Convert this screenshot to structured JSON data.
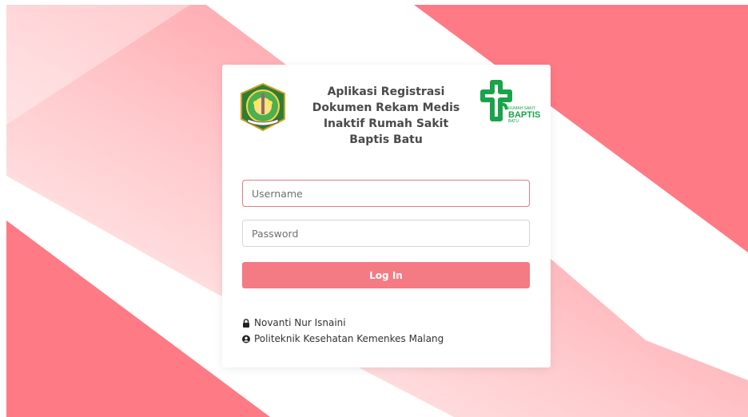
{
  "app": {
    "title": "Aplikasi Registrasi Dokumen Rekam Medis Inaktif Rumah Sakit Baptis Batu",
    "title_lines": [
      "Aplikasi Registrasi",
      "Dokumen Rekam Medis",
      "Inaktif Rumah Sakit",
      "Baptis Batu"
    ]
  },
  "logos": {
    "left": {
      "icon": "government-seal-icon"
    },
    "right": {
      "icon": "rumah-sakit-baptis-batu-logo",
      "text_top": "RUMAH SAKIT",
      "text_main": "BAPTIS",
      "text_bottom": "BATU"
    }
  },
  "form": {
    "username": {
      "placeholder": "Username",
      "value": ""
    },
    "password": {
      "placeholder": "Password",
      "value": ""
    },
    "login_label": "Log In"
  },
  "credits": [
    {
      "icon": "lock-icon",
      "text": "Novanti Nur Isnaini"
    },
    {
      "icon": "user-circle-icon",
      "text": "Politeknik Kesehatan Kemenkes Malang"
    }
  ],
  "colors": {
    "accent": "#f47a83",
    "stripe": "#fd7a84",
    "logo_green": "#1aa34a",
    "text": "#4a4a4a"
  }
}
